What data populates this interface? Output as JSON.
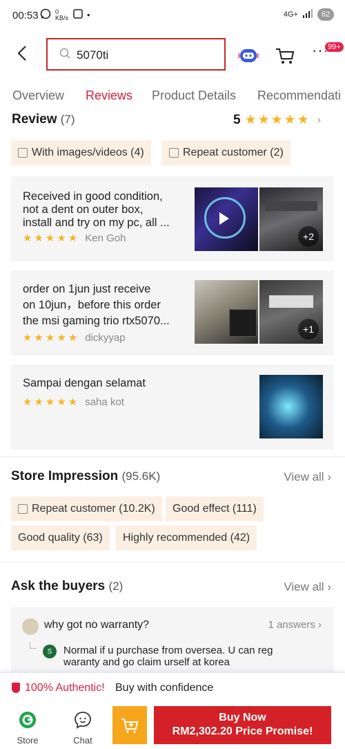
{
  "status_bar": {
    "time": "00:53",
    "speed": "0 KB/s",
    "network": "4G+",
    "battery": "62"
  },
  "header": {
    "search_value": "5070ti",
    "notification_badge": "99+"
  },
  "tabs": [
    {
      "label": "Overview"
    },
    {
      "label": "Reviews"
    },
    {
      "label": "Product Details"
    },
    {
      "label": "Recommendati"
    }
  ],
  "review_section": {
    "title": "Review",
    "count": "(7)",
    "score": "5",
    "stars": "★★★★★",
    "filters": [
      {
        "label": "With images/videos (4)"
      },
      {
        "label": "Repeat customer (2)"
      }
    ],
    "reviews": [
      {
        "text_lines": [
          "Received in good condition,",
          "not a dent on outer box,",
          "install and try on my pc, all ..."
        ],
        "stars": "★★★★★",
        "author": "Ken Goh",
        "extra_images": "+2"
      },
      {
        "text_lines": [
          "order on 1jun just receive",
          "on 10jun，before this order",
          "the msi gaming trio rtx5070..."
        ],
        "stars": "★★★★★",
        "author": "dickyyap",
        "extra_images": "+1"
      },
      {
        "text_lines": [
          "Sampai dengan selamat"
        ],
        "stars": "★★★★★",
        "author": "saha kot"
      }
    ]
  },
  "store_impression": {
    "title": "Store Impression",
    "count": "(95.6K)",
    "view_all": "View all",
    "tags": [
      {
        "label": "Repeat customer (10.2K)"
      },
      {
        "label": "Good effect (111)"
      },
      {
        "label": "Good quality (63)"
      },
      {
        "label": "Highly recommended (42)"
      }
    ]
  },
  "ask_buyers": {
    "title": "Ask the buyers",
    "count": "(2)",
    "view_all": "View all",
    "question": "why got no warranty?",
    "answer_count": "1 answers",
    "answer_avatar": "S",
    "answer_lines": [
      "Normal if u purchase from oversea. U can reg",
      "waranty and go claim urself at korea"
    ]
  },
  "authentic_bar": {
    "highlight": "100% Authentic!",
    "text": "Buy with confidence"
  },
  "bottom_bar": {
    "store_label": "Store",
    "chat_label": "Chat",
    "buy_now_line1": "Buy Now",
    "buy_now_line2": "RM2,302.20 Price Promise!"
  },
  "colors": {
    "brand_red": "#d81e40",
    "star_yellow": "#f7b422",
    "buy_red": "#d32127",
    "cart_orange": "#f6a61b",
    "chip_bg": "#fbefe3"
  }
}
